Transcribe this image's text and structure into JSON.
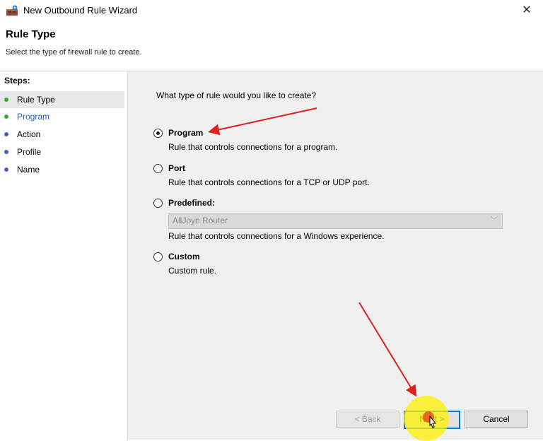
{
  "window": {
    "title": "New Outbound Rule Wizard",
    "close_glyph": "✕"
  },
  "header": {
    "title": "Rule Type",
    "subtitle": "Select the type of firewall rule to create."
  },
  "steps": {
    "label": "Steps:",
    "items": [
      {
        "label": "Rule Type",
        "color": "#3aaa35",
        "active": true
      },
      {
        "label": "Program",
        "color": "#3aaa35",
        "link": true
      },
      {
        "label": "Action",
        "color": "#4a5fc8"
      },
      {
        "label": "Profile",
        "color": "#4a5fc8"
      },
      {
        "label": "Name",
        "color": "#4a5fc8"
      }
    ]
  },
  "main": {
    "question": "What type of rule would you like to create?",
    "options": [
      {
        "label": "Program",
        "desc": "Rule that controls connections for a program.",
        "checked": true
      },
      {
        "label": "Port",
        "desc": "Rule that controls connections for a TCP or UDP port."
      },
      {
        "label": "Predefined:",
        "desc": "Rule that controls connections for a Windows experience."
      },
      {
        "label": "Custom",
        "desc": "Custom rule."
      }
    ],
    "predefined_dropdown": {
      "value": "AllJoyn Router",
      "chevron": "﹀"
    }
  },
  "buttons": {
    "back": "< Back",
    "next": "Next >",
    "cancel": "Cancel"
  },
  "colors": {
    "accent": "#0078d7",
    "annotation": "#e0201c",
    "highlight": "#fff000"
  }
}
